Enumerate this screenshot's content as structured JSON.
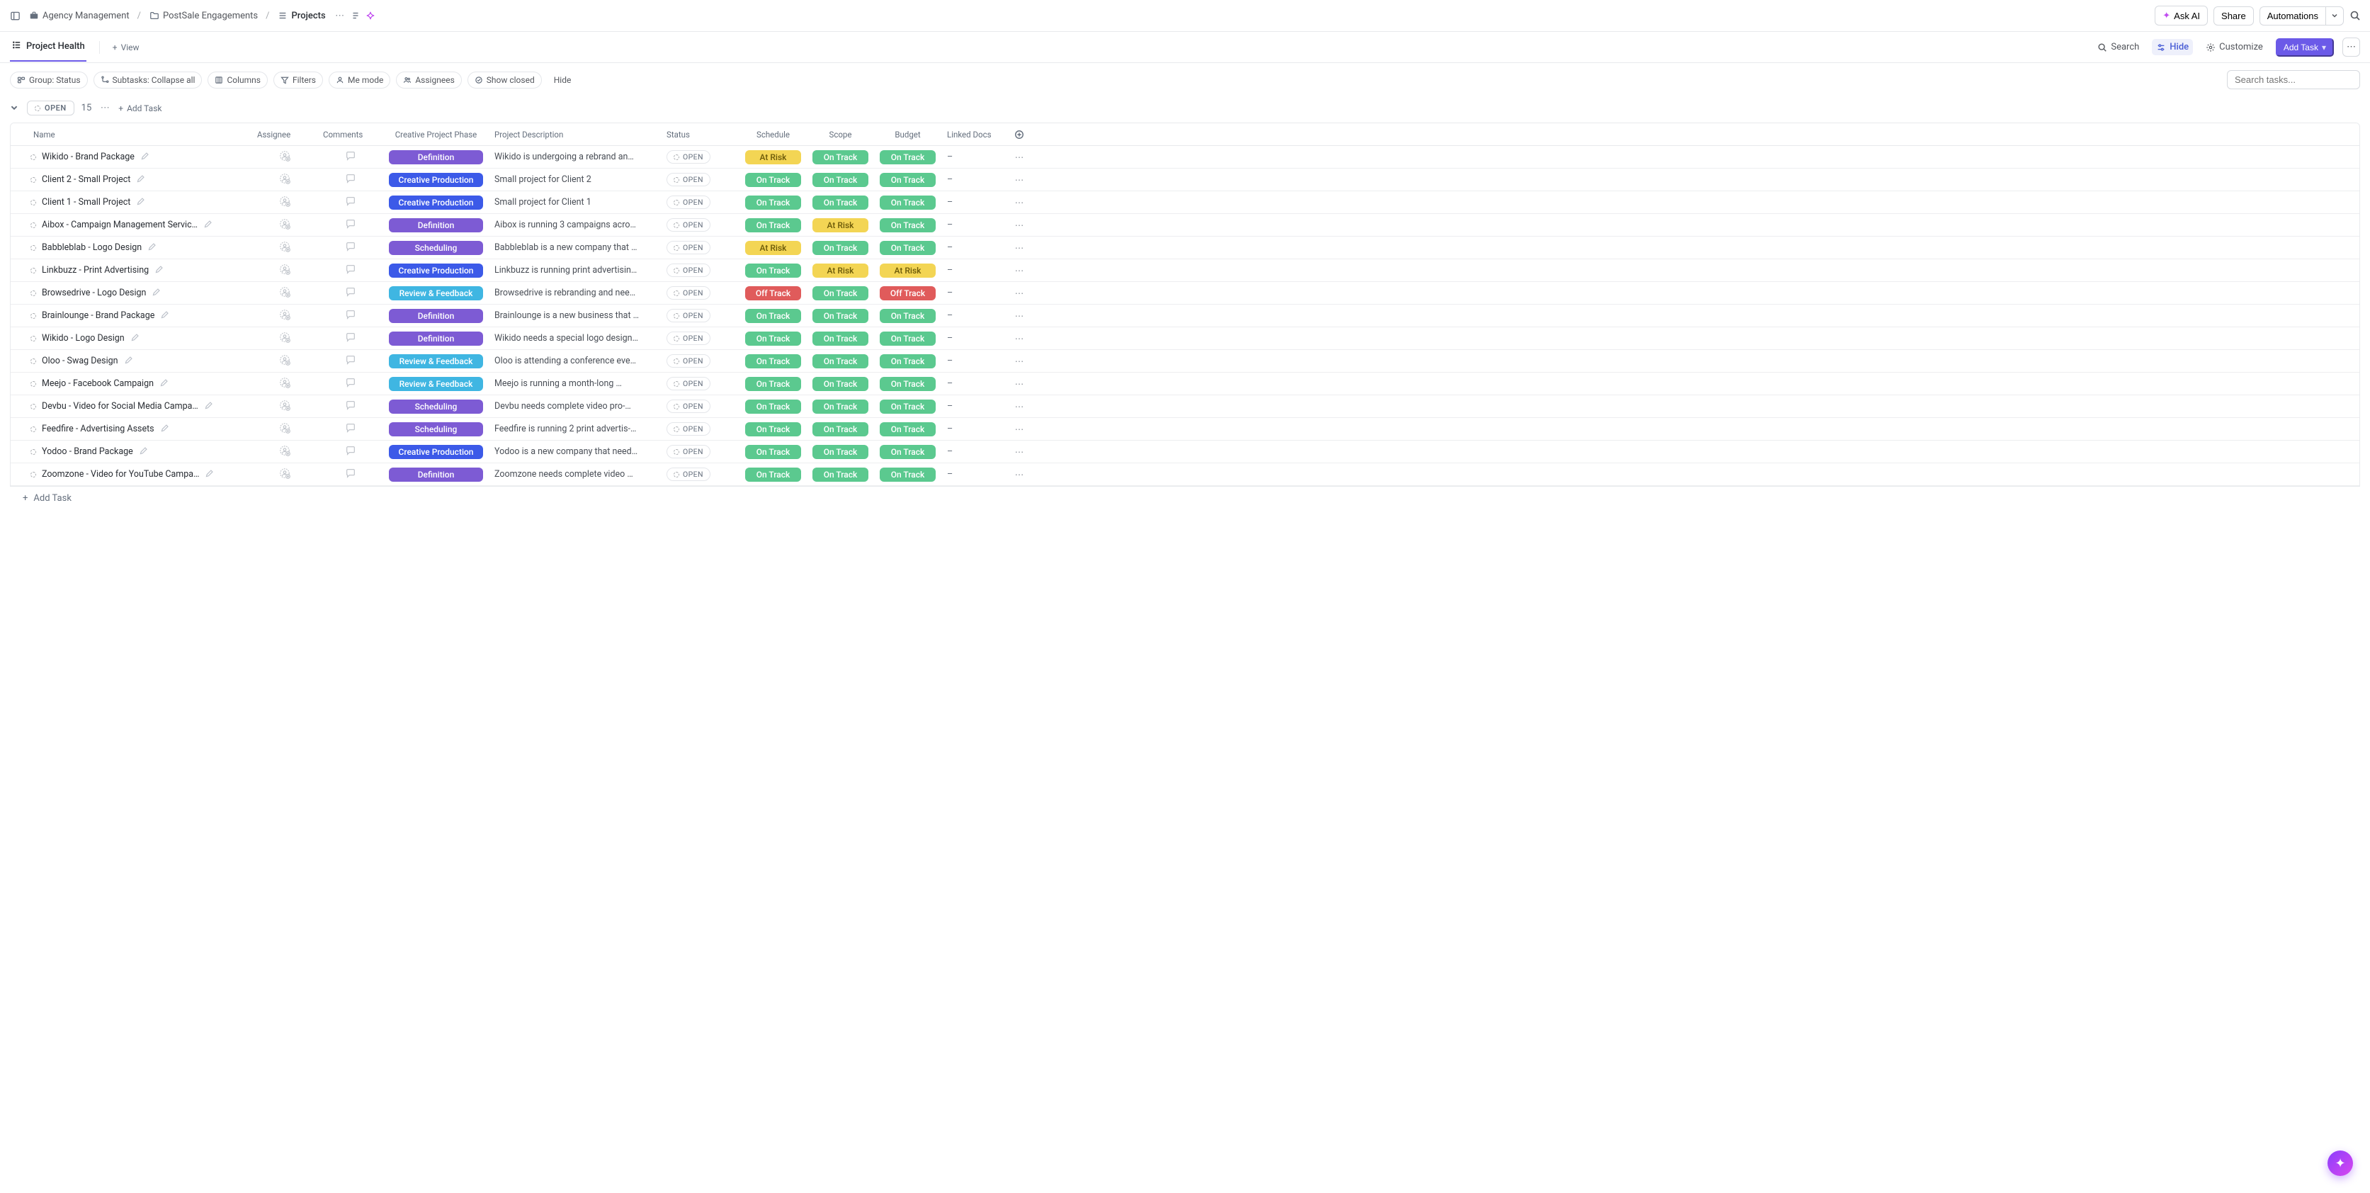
{
  "breadcrumb": [
    {
      "icon": "briefcase",
      "label": "Agency Management"
    },
    {
      "icon": "folder",
      "label": "PostSale Engagements"
    },
    {
      "icon": "list",
      "label": "Projects"
    }
  ],
  "top_actions": {
    "ask_ai": "Ask AI",
    "share": "Share",
    "automations": "Automations"
  },
  "views": {
    "active": "Project Health",
    "add_view": "View"
  },
  "view_actions": {
    "search": "Search",
    "hide": "Hide",
    "customize": "Customize",
    "add_task": "Add Task"
  },
  "filters": {
    "group": "Group: Status",
    "subtasks": "Subtasks: Collapse all",
    "columns": "Columns",
    "filters": "Filters",
    "me_mode": "Me mode",
    "assignees": "Assignees",
    "show_closed": "Show closed",
    "hide": "Hide",
    "search_placeholder": "Search tasks..."
  },
  "group": {
    "status_label": "OPEN",
    "count": "15",
    "add_task": "Add Task"
  },
  "columns": [
    "Name",
    "Assignee",
    "Comments",
    "Creative Project Phase",
    "Project Description",
    "Status",
    "Schedule",
    "Scope",
    "Budget",
    "Linked Docs"
  ],
  "phases": {
    "definition": {
      "label": "Definition",
      "class": "purple"
    },
    "production": {
      "label": "Creative Production",
      "class": "blue"
    },
    "scheduling": {
      "label": "Scheduling",
      "class": "purple"
    },
    "review": {
      "label": "Review & Feedback",
      "class": "teal"
    }
  },
  "health": {
    "ontrack": {
      "label": "On Track",
      "class": "green"
    },
    "atrisk": {
      "label": "At Risk",
      "class": "yellow"
    },
    "offtrack": {
      "label": "Off Track",
      "class": "red"
    }
  },
  "status_open": "OPEN",
  "linked_dash": "–",
  "add_task_bottom": "Add Task",
  "tasks": [
    {
      "name": "Wikido - Brand Package",
      "phase": "definition",
      "desc": "Wikido is undergoing a rebrand an…",
      "schedule": "atrisk",
      "scope": "ontrack",
      "budget": "ontrack"
    },
    {
      "name": "Client 2 - Small Project",
      "phase": "production",
      "desc": "Small project for Client 2",
      "schedule": "ontrack",
      "scope": "ontrack",
      "budget": "ontrack"
    },
    {
      "name": "Client 1 - Small Project",
      "phase": "production",
      "desc": "Small project for Client 1",
      "schedule": "ontrack",
      "scope": "ontrack",
      "budget": "ontrack"
    },
    {
      "name": "Aibox - Campaign Management Servic…",
      "phase": "definition",
      "desc": "Aibox is running 3 campaigns acro…",
      "schedule": "ontrack",
      "scope": "atrisk",
      "budget": "ontrack"
    },
    {
      "name": "Babbleblab - Logo Design",
      "phase": "scheduling",
      "desc": "Babbleblab is a new company that …",
      "schedule": "atrisk",
      "scope": "ontrack",
      "budget": "ontrack"
    },
    {
      "name": "Linkbuzz - Print Advertising",
      "phase": "production",
      "desc": "Linkbuzz is running print advertisin…",
      "schedule": "ontrack",
      "scope": "atrisk",
      "budget": "atrisk"
    },
    {
      "name": "Browsedrive - Logo Design",
      "phase": "review",
      "desc": "Browsedrive is rebranding and nee…",
      "schedule": "offtrack",
      "scope": "ontrack",
      "budget": "offtrack"
    },
    {
      "name": "Brainlounge - Brand Package",
      "phase": "definition",
      "desc": "Brainlounge is a new business that …",
      "schedule": "ontrack",
      "scope": "ontrack",
      "budget": "ontrack"
    },
    {
      "name": "Wikido - Logo Design",
      "phase": "definition",
      "desc": "Wikido needs a special logo design…",
      "schedule": "ontrack",
      "scope": "ontrack",
      "budget": "ontrack"
    },
    {
      "name": "Oloo - Swag Design",
      "phase": "review",
      "desc": "Oloo is attending a conference eve…",
      "schedule": "ontrack",
      "scope": "ontrack",
      "budget": "ontrack"
    },
    {
      "name": "Meejo - Facebook Campaign",
      "phase": "review",
      "desc": "Meejo is running a month-long …",
      "schedule": "ontrack",
      "scope": "ontrack",
      "budget": "ontrack"
    },
    {
      "name": "Devbu - Video for Social Media Campa…",
      "phase": "scheduling",
      "desc": "Devbu needs complete video pro-…",
      "schedule": "ontrack",
      "scope": "ontrack",
      "budget": "ontrack"
    },
    {
      "name": "Feedfire - Advertising Assets",
      "phase": "scheduling",
      "desc": "Feedfire is running 2 print advertis-…",
      "schedule": "ontrack",
      "scope": "ontrack",
      "budget": "ontrack"
    },
    {
      "name": "Yodoo - Brand Package",
      "phase": "production",
      "desc": "Yodoo is a new company that need…",
      "schedule": "ontrack",
      "scope": "ontrack",
      "budget": "ontrack"
    },
    {
      "name": "Zoomzone - Video for YouTube Campa…",
      "phase": "definition",
      "desc": "Zoomzone needs complete video …",
      "schedule": "ontrack",
      "scope": "ontrack",
      "budget": "ontrack"
    }
  ]
}
